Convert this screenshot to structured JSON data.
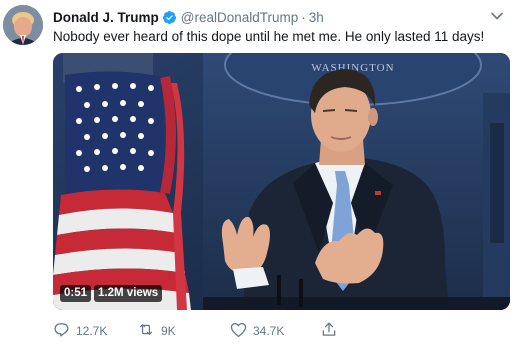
{
  "tweet": {
    "author_name": "Donald J. Trump",
    "handle": "@realDonaldTrump",
    "separator": "·",
    "time": "3h",
    "text": "Nobody ever heard of this dope until he met me. He only lasted 11 days!"
  },
  "media": {
    "type": "video",
    "duration": "0:51",
    "views": "1.2M views",
    "background_sign_text": "WASHINGTON"
  },
  "actions": {
    "replies": "12.7K",
    "retweets": "9K",
    "likes": "34.7K"
  },
  "colors": {
    "text": "#14171a",
    "muted": "#657786",
    "verified": "#1da1f2",
    "video_bg": "#1d2a3e"
  },
  "icons": {
    "verified": "verified-badge-icon",
    "menu": "chevron-down-icon",
    "reply": "reply-icon",
    "retweet": "retweet-icon",
    "like": "heart-icon",
    "share": "share-icon"
  }
}
